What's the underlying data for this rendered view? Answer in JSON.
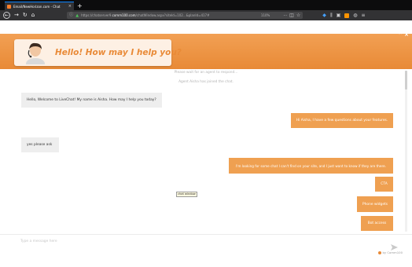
{
  "browser": {
    "tab_title": "Email/NewHorizon.com - Chat",
    "tab_close": "×",
    "new_tab": "+",
    "url_prefix": "https://chatserver9.",
    "url_domain": "comm100.com",
    "url_suffix": "/chatWindow.aspx?siteId=102...&planId=417#",
    "zoom": "110%",
    "more": "···"
  },
  "chat": {
    "window_more": "···",
    "window_close": "×",
    "greeting": "Hello! How may I help you?",
    "system_messages": [
      "Please wait for an agent to respond...",
      "Agent Aisha has joined the chat."
    ],
    "messages": [
      {
        "sender": "agent",
        "text": "Hello, Welcome to LiveChat! My name is Aisha. How may I help you today?"
      },
      {
        "sender": "user",
        "text": "Hi Aisha, I have a few questions about your features."
      },
      {
        "sender": "agent",
        "text": "yes please ask"
      },
      {
        "sender": "user",
        "text": "I'm looking for some chat I can't find on your site, and I just want to know if they are there."
      },
      {
        "sender": "user",
        "text": "CTA"
      },
      {
        "sender": "user",
        "text": "Phone widgets"
      },
      {
        "sender": "user",
        "text": "Bot access"
      }
    ],
    "tooltip": "chat window",
    "composer_placeholder": "Type a message here",
    "branding": "by Comm100"
  },
  "colors": {
    "accent": "#e98a37",
    "user_bubble": "#efa051",
    "agent_bubble": "#eeeeee"
  }
}
